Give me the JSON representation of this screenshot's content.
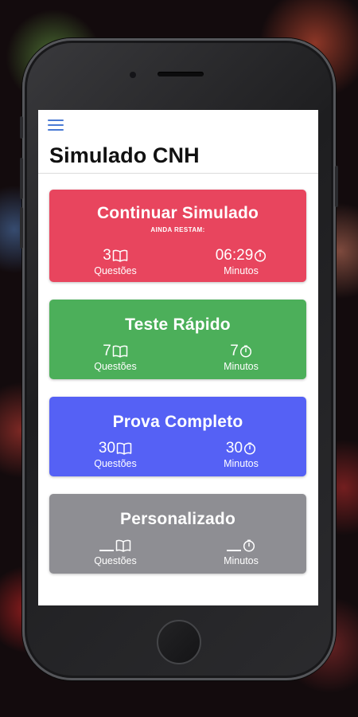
{
  "app": {
    "title": "Simulado CNH"
  },
  "colors": {
    "menu": "#4a7ad4",
    "continuar": "#e8455e",
    "teste": "#4caf5a",
    "prova": "#5561f5",
    "personalizado": "#8e8e93"
  },
  "cards": {
    "continuar": {
      "title": "Continuar Simulado",
      "subtitle": "AINDA RESTAM:",
      "questions_value": "3",
      "questions_label": "Questões",
      "minutes_value": "06:29",
      "minutes_label": "Minutos"
    },
    "teste": {
      "title": "Teste Rápido",
      "questions_value": "7",
      "questions_label": "Questões",
      "minutes_value": "7",
      "minutes_label": "Minutos"
    },
    "prova": {
      "title": "Prova Completo",
      "questions_value": "30",
      "questions_label": "Questões",
      "minutes_value": "30",
      "minutes_label": "Minutos"
    },
    "personalizado": {
      "title": "Personalizado",
      "questions_label": "Questões",
      "minutes_label": "Minutos"
    }
  },
  "icons": {
    "menu": "hamburger-menu-icon",
    "questions": "book-icon",
    "minutes": "timer-icon"
  }
}
